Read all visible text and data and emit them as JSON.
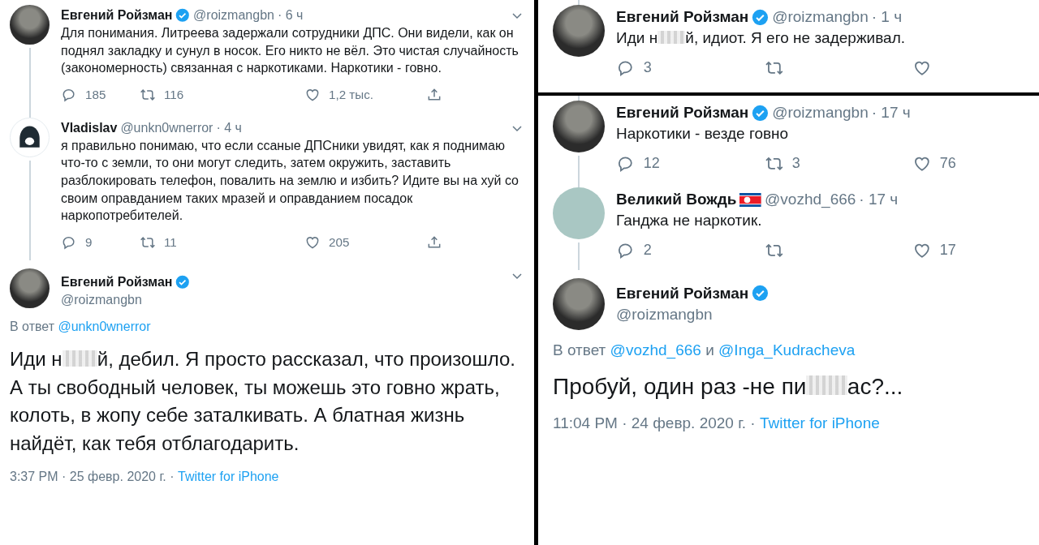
{
  "left_panel": {
    "items": [
      {
        "kind": "tweet",
        "avatar": {
          "kind": "photo"
        },
        "name": "Евгений Ройзман",
        "badge": {
          "kind": "verified"
        },
        "handle": "@roizmangbn",
        "time": "· 6 ч",
        "thread_above": false,
        "thread_below": true,
        "menu": true,
        "text_parts": [
          "Для понимания. Литреева задержали сотрудники ДПС. Они видели, как он поднял закладку и сунул в носок. Его никто не вёл. Это чистая случайность (закономерность) связанная с наркотиками. Наркотики - говно."
        ],
        "stats": [
          {
            "kind": "reply",
            "count": "185"
          },
          {
            "kind": "retweet",
            "count": "116"
          },
          {
            "kind": "like",
            "count": "1,2 тыс."
          },
          {
            "kind": "share"
          }
        ]
      },
      {
        "kind": "tweet",
        "avatar": {
          "kind": "hooded"
        },
        "name": "Vladislav",
        "handle": "@unkn0wnerror",
        "time": "· 4 ч",
        "thread_above": true,
        "thread_below": true,
        "menu": true,
        "text_parts": [
          "я правильно понимаю, что если ссаные ДПСники увидят, как я поднимаю что-то с земли, то они могут следить, затем окружить, заставить разблокировать телефон, повалить на землю и избить? Идите вы на хуй со своим оправданием таких мразей и оправданием посадок наркопотребителей."
        ],
        "stats": [
          {
            "kind": "reply",
            "count": "9"
          },
          {
            "kind": "retweet",
            "count": "11"
          },
          {
            "kind": "like",
            "count": "205"
          },
          {
            "kind": "share"
          }
        ]
      },
      {
        "kind": "focused",
        "avatar": {
          "kind": "photo"
        },
        "name": "Евгений Ройзман",
        "badge": {
          "kind": "verified"
        },
        "handle": "@roizmangbn",
        "menu": true,
        "reply_prefix": "В ответ",
        "reply_links": [
          "@unkn0wnerror"
        ],
        "text_parts": [
          "Иди н",
          "й, дебил. Я просто рассказал, что произошло. А ты свободный человек, ты можешь это говно жрать, колоть, в жопу себе заталкивать. А блатная жизнь найдёт, как тебя отблагодарить."
        ],
        "meta": "3:37 PM · 25 февр. 2020 г. ·",
        "source": "Twitter for iPhone"
      }
    ]
  },
  "right_top_panel": {
    "items": [
      {
        "kind": "tweet",
        "avatar": {
          "kind": "photo"
        },
        "name": "Евгений Ройзман",
        "badge": {
          "kind": "verified"
        },
        "handle": "@roizmangbn",
        "time": "· 1 ч",
        "thread_above": true,
        "thread_below": false,
        "menu": false,
        "text_parts": [
          "Иди н",
          "й, идиот. Я его не задерживал."
        ],
        "stats": [
          {
            "kind": "reply",
            "count": "3"
          },
          {
            "kind": "retweet"
          },
          {
            "kind": "like"
          }
        ]
      }
    ]
  },
  "right_bottom_panel": {
    "items": [
      {
        "kind": "tweet",
        "avatar": {
          "kind": "photo"
        },
        "name": "Евгений Ройзман",
        "badge": {
          "kind": "verified"
        },
        "handle": "@roizmangbn",
        "time": "· 17 ч",
        "thread_above": true,
        "thread_below": true,
        "menu": false,
        "text_parts": [
          "Наркотики - везде говно"
        ],
        "stats": [
          {
            "kind": "reply",
            "count": "12"
          },
          {
            "kind": "retweet",
            "count": "3"
          },
          {
            "kind": "like",
            "count": "76"
          }
        ]
      },
      {
        "kind": "tweet",
        "avatar": {
          "kind": "cartoon"
        },
        "name": "Великий Вождь",
        "badge": {
          "kind": "flag"
        },
        "handle": "@vozhd_666",
        "time": "· 17 ч",
        "thread_above": true,
        "thread_below": true,
        "menu": false,
        "text_parts": [
          "Ганджа не наркотик."
        ],
        "stats": [
          {
            "kind": "reply",
            "count": "2"
          },
          {
            "kind": "retweet"
          },
          {
            "kind": "like",
            "count": "17"
          }
        ]
      },
      {
        "kind": "focused",
        "avatar": {
          "kind": "photo"
        },
        "name": "Евгений Ройзман",
        "badge": {
          "kind": "verified"
        },
        "handle": "@roizmangbn",
        "menu": false,
        "reply_prefix": "В ответ",
        "reply_links": [
          "@vozhd_666",
          "@Inga_Kudracheva"
        ],
        "reply_joiner": "и",
        "text_parts": [
          "Пробуй, один раз -не пи",
          "ас?..."
        ],
        "meta": "11:04 PM · 24 февр. 2020 г. ·",
        "source": "Twitter for iPhone"
      }
    ]
  }
}
